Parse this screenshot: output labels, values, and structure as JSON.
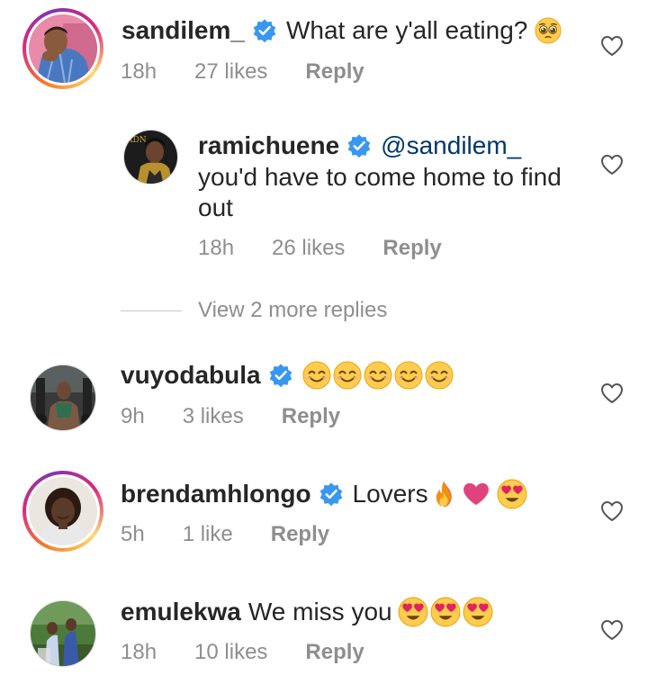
{
  "comments": [
    {
      "username": "sandilem_",
      "text": "What are y'all eating?",
      "time": "18h",
      "likes": "27 likes",
      "reply": "Reply"
    },
    {
      "username": "ramichuene",
      "mention": "@sandilem_",
      "text_line1": "you'd have to come home to find",
      "text_line2": "out",
      "time": "18h",
      "likes": "26 likes",
      "reply": "Reply"
    },
    {
      "username": "vuyodabula",
      "time": "9h",
      "likes": "3 likes",
      "reply": "Reply"
    },
    {
      "username": "brendamhlongo",
      "text": "Lovers",
      "time": "5h",
      "likes": "1 like",
      "reply": "Reply"
    },
    {
      "username": "emulekwa",
      "text": "We miss you",
      "time": "18h",
      "likes": "10 likes",
      "reply": "Reply"
    }
  ],
  "view_more_replies": "View 2 more replies",
  "colors": {
    "verified": "#3897f0",
    "meta": "#8e8e8e",
    "mention": "#00376b"
  },
  "icons": [
    "verified-badge-icon",
    "heart-outline-icon",
    "pleading-face-emoji",
    "smiling-face-emoji",
    "fire-emoji",
    "pink-heart-emoji",
    "heart-eyes-emoji"
  ]
}
